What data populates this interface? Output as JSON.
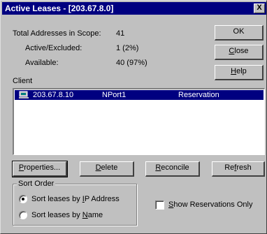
{
  "window": {
    "title": "Active Leases - [203.67.8.0]",
    "close_glyph": "X"
  },
  "stats": {
    "total_label": "Total Addresses in Scope:",
    "total_value": "41",
    "excluded_label": "Active/Excluded:",
    "excluded_value": "1 (2%)",
    "available_label": "Available:",
    "available_value": "40 (97%)"
  },
  "buttons": {
    "ok": "OK",
    "close_mn": "C",
    "close_rest": "lose",
    "help_mn": "H",
    "help_rest": "elp",
    "properties_mn": "P",
    "properties_rest": "roperties...",
    "delete_mn": "D",
    "delete_rest": "elete",
    "reconcile_mn": "R",
    "reconcile_rest": "econcile",
    "refresh_pre": "Re",
    "refresh_mn": "f",
    "refresh_rest": "resh"
  },
  "client_list": {
    "header": "Client",
    "rows": [
      {
        "ip": "203.67.8.10",
        "name": "NPort1",
        "type": "Reservation",
        "icon": "computer-icon"
      }
    ]
  },
  "sort_order": {
    "title": "Sort Order",
    "by_ip_pre": "Sort leases by ",
    "by_ip_mn": "I",
    "by_ip_rest": "P Address",
    "by_name_pre": "Sort leases by ",
    "by_name_mn": "N",
    "by_name_rest": "ame",
    "selected": "ip"
  },
  "show_reservations": {
    "label_mn": "S",
    "label_rest": "how Reservations Only",
    "checked": false
  },
  "colors": {
    "titlebar": "#000080",
    "face": "#c0c0c0",
    "selection": "#000080"
  }
}
